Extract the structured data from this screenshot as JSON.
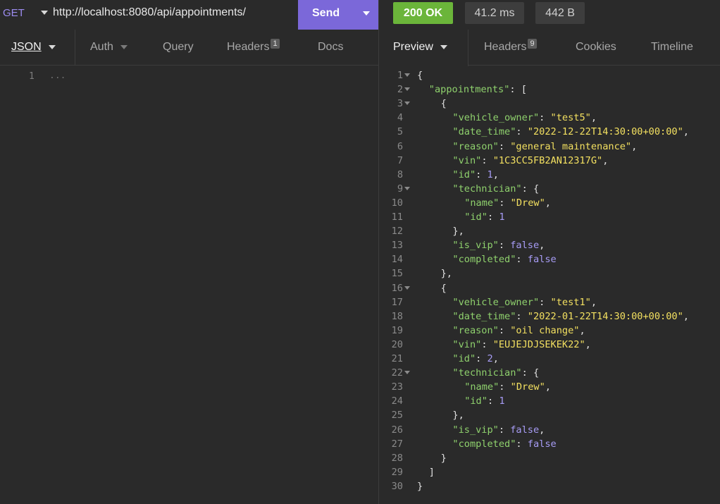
{
  "request": {
    "method": "GET",
    "url": "http://localhost:8080/api/appointments/",
    "send_label": "Send"
  },
  "response_meta": {
    "status": "200 OK",
    "time": "41.2 ms",
    "size": "442 B"
  },
  "request_tabs": [
    {
      "label": "JSON",
      "badge": ""
    },
    {
      "label": "Auth",
      "badge": ""
    },
    {
      "label": "Query",
      "badge": ""
    },
    {
      "label": "Headers",
      "badge": "1"
    },
    {
      "label": "Docs",
      "badge": ""
    }
  ],
  "response_tabs": [
    {
      "label": "Preview",
      "badge": ""
    },
    {
      "label": "Headers",
      "badge": "9"
    },
    {
      "label": "Cookies",
      "badge": ""
    },
    {
      "label": "Timeline",
      "badge": ""
    }
  ],
  "request_body": {
    "line_number": "1",
    "placeholder": "..."
  },
  "response_lines": [
    {
      "n": "1",
      "fold": true,
      "indent": 0,
      "parts": [
        [
          "p",
          "{"
        ]
      ]
    },
    {
      "n": "2",
      "fold": true,
      "indent": 1,
      "parts": [
        [
          "k",
          "\"appointments\""
        ],
        [
          "p",
          ": ["
        ]
      ]
    },
    {
      "n": "3",
      "fold": true,
      "indent": 2,
      "parts": [
        [
          "p",
          "{"
        ]
      ]
    },
    {
      "n": "4",
      "fold": false,
      "indent": 3,
      "parts": [
        [
          "k",
          "\"vehicle_owner\""
        ],
        [
          "p",
          ": "
        ],
        [
          "s",
          "\"test5\""
        ],
        [
          "p",
          ","
        ]
      ]
    },
    {
      "n": "5",
      "fold": false,
      "indent": 3,
      "parts": [
        [
          "k",
          "\"date_time\""
        ],
        [
          "p",
          ": "
        ],
        [
          "s",
          "\"2022-12-22T14:30:00+00:00\""
        ],
        [
          "p",
          ","
        ]
      ]
    },
    {
      "n": "6",
      "fold": false,
      "indent": 3,
      "parts": [
        [
          "k",
          "\"reason\""
        ],
        [
          "p",
          ": "
        ],
        [
          "s",
          "\"general maintenance\""
        ],
        [
          "p",
          ","
        ]
      ]
    },
    {
      "n": "7",
      "fold": false,
      "indent": 3,
      "parts": [
        [
          "k",
          "\"vin\""
        ],
        [
          "p",
          ": "
        ],
        [
          "s",
          "\"1C3CC5FB2AN12317G\""
        ],
        [
          "p",
          ","
        ]
      ]
    },
    {
      "n": "8",
      "fold": false,
      "indent": 3,
      "parts": [
        [
          "k",
          "\"id\""
        ],
        [
          "p",
          ": "
        ],
        [
          "n",
          "1"
        ],
        [
          "p",
          ","
        ]
      ]
    },
    {
      "n": "9",
      "fold": true,
      "indent": 3,
      "parts": [
        [
          "k",
          "\"technician\""
        ],
        [
          "p",
          ": {"
        ]
      ]
    },
    {
      "n": "10",
      "fold": false,
      "indent": 4,
      "parts": [
        [
          "k",
          "\"name\""
        ],
        [
          "p",
          ": "
        ],
        [
          "s",
          "\"Drew\""
        ],
        [
          "p",
          ","
        ]
      ]
    },
    {
      "n": "11",
      "fold": false,
      "indent": 4,
      "parts": [
        [
          "k",
          "\"id\""
        ],
        [
          "p",
          ": "
        ],
        [
          "n",
          "1"
        ]
      ]
    },
    {
      "n": "12",
      "fold": false,
      "indent": 3,
      "parts": [
        [
          "p",
          "},"
        ]
      ]
    },
    {
      "n": "13",
      "fold": false,
      "indent": 3,
      "parts": [
        [
          "k",
          "\"is_vip\""
        ],
        [
          "p",
          ": "
        ],
        [
          "b",
          "false"
        ],
        [
          "p",
          ","
        ]
      ]
    },
    {
      "n": "14",
      "fold": false,
      "indent": 3,
      "parts": [
        [
          "k",
          "\"completed\""
        ],
        [
          "p",
          ": "
        ],
        [
          "b",
          "false"
        ]
      ]
    },
    {
      "n": "15",
      "fold": false,
      "indent": 2,
      "parts": [
        [
          "p",
          "},"
        ]
      ]
    },
    {
      "n": "16",
      "fold": true,
      "indent": 2,
      "parts": [
        [
          "p",
          "{"
        ]
      ]
    },
    {
      "n": "17",
      "fold": false,
      "indent": 3,
      "parts": [
        [
          "k",
          "\"vehicle_owner\""
        ],
        [
          "p",
          ": "
        ],
        [
          "s",
          "\"test1\""
        ],
        [
          "p",
          ","
        ]
      ]
    },
    {
      "n": "18",
      "fold": false,
      "indent": 3,
      "parts": [
        [
          "k",
          "\"date_time\""
        ],
        [
          "p",
          ": "
        ],
        [
          "s",
          "\"2022-01-22T14:30:00+00:00\""
        ],
        [
          "p",
          ","
        ]
      ]
    },
    {
      "n": "19",
      "fold": false,
      "indent": 3,
      "parts": [
        [
          "k",
          "\"reason\""
        ],
        [
          "p",
          ": "
        ],
        [
          "s",
          "\"oil change\""
        ],
        [
          "p",
          ","
        ]
      ]
    },
    {
      "n": "20",
      "fold": false,
      "indent": 3,
      "parts": [
        [
          "k",
          "\"vin\""
        ],
        [
          "p",
          ": "
        ],
        [
          "s",
          "\"EUJEJDJSEKEK22\""
        ],
        [
          "p",
          ","
        ]
      ]
    },
    {
      "n": "21",
      "fold": false,
      "indent": 3,
      "parts": [
        [
          "k",
          "\"id\""
        ],
        [
          "p",
          ": "
        ],
        [
          "n",
          "2"
        ],
        [
          "p",
          ","
        ]
      ]
    },
    {
      "n": "22",
      "fold": true,
      "indent": 3,
      "parts": [
        [
          "k",
          "\"technician\""
        ],
        [
          "p",
          ": {"
        ]
      ]
    },
    {
      "n": "23",
      "fold": false,
      "indent": 4,
      "parts": [
        [
          "k",
          "\"name\""
        ],
        [
          "p",
          ": "
        ],
        [
          "s",
          "\"Drew\""
        ],
        [
          "p",
          ","
        ]
      ]
    },
    {
      "n": "24",
      "fold": false,
      "indent": 4,
      "parts": [
        [
          "k",
          "\"id\""
        ],
        [
          "p",
          ": "
        ],
        [
          "n",
          "1"
        ]
      ]
    },
    {
      "n": "25",
      "fold": false,
      "indent": 3,
      "parts": [
        [
          "p",
          "},"
        ]
      ]
    },
    {
      "n": "26",
      "fold": false,
      "indent": 3,
      "parts": [
        [
          "k",
          "\"is_vip\""
        ],
        [
          "p",
          ": "
        ],
        [
          "b",
          "false"
        ],
        [
          "p",
          ","
        ]
      ]
    },
    {
      "n": "27",
      "fold": false,
      "indent": 3,
      "parts": [
        [
          "k",
          "\"completed\""
        ],
        [
          "p",
          ": "
        ],
        [
          "b",
          "false"
        ]
      ]
    },
    {
      "n": "28",
      "fold": false,
      "indent": 2,
      "parts": [
        [
          "p",
          "}"
        ]
      ]
    },
    {
      "n": "29",
      "fold": false,
      "indent": 1,
      "parts": [
        [
          "p",
          "]"
        ]
      ]
    },
    {
      "n": "30",
      "fold": false,
      "indent": 0,
      "parts": [
        [
          "p",
          "}"
        ]
      ]
    }
  ]
}
